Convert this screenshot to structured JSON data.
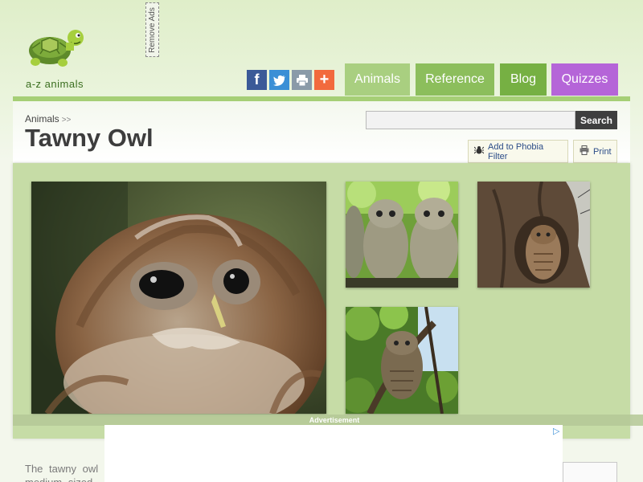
{
  "header": {
    "logo_text": "a-z animals",
    "remove_ads": "Remove Ads",
    "social": [
      {
        "name": "facebook",
        "glyph": "f"
      },
      {
        "name": "twitter",
        "glyph": "🐦"
      },
      {
        "name": "print",
        "glyph": "⎙"
      },
      {
        "name": "more",
        "glyph": "+"
      }
    ],
    "nav": [
      {
        "label": "Animals"
      },
      {
        "label": "Reference"
      },
      {
        "label": "Blog"
      },
      {
        "label": "Quizzes"
      }
    ]
  },
  "breadcrumb": {
    "item": "Animals",
    "separator": ">>"
  },
  "page_title": "Tawny Owl",
  "search": {
    "value": "",
    "placeholder": "",
    "button": "Search"
  },
  "actions": {
    "phobia": "Add to Phobia Filter",
    "print": "Print"
  },
  "ad": {
    "label": "Advertisement"
  },
  "intro_text": "The tawny owl medium sized bir",
  "colors": {
    "nav_animals": "#a9cf80",
    "nav_reference": "#8cbe5c",
    "nav_blog": "#76b043",
    "nav_quizzes": "#b565d8",
    "accent_bar": "#a6cf76",
    "gallery_bg": "#c6dca6"
  }
}
